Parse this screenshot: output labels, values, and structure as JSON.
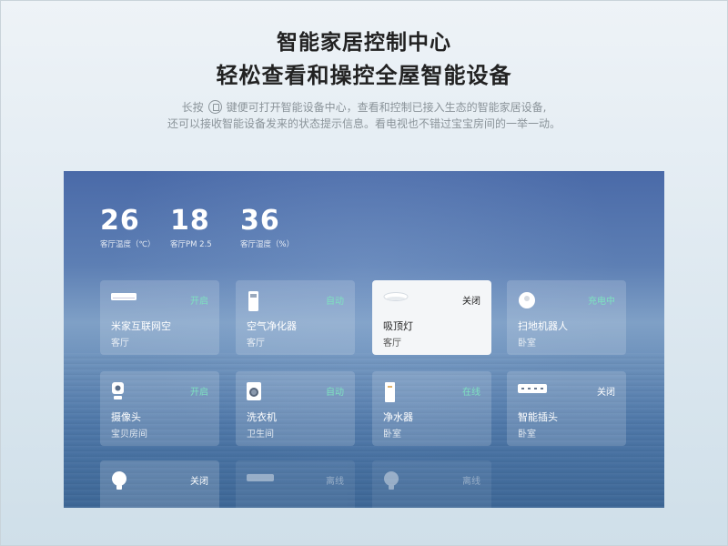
{
  "header": {
    "title": "智能家居控制中心",
    "subtitle": "轻松查看和操控全屋智能设备",
    "desc_prefix": "长按",
    "desc_line1_rest": "键便可打开智能设备中心，查看和控制已接入生态的智能家居设备,",
    "desc_line2": "还可以接收智能设备发来的状态提示信息。看电视也不错过宝宝房间的一举一动。",
    "home_icon": "home-key-icon"
  },
  "stats": [
    {
      "value": "26",
      "label": "客厅温度（℃）"
    },
    {
      "value": "18",
      "label": "客厅PM 2.5"
    },
    {
      "value": "36",
      "label": "客厅湿度（%）"
    }
  ],
  "devices": [
    {
      "name": "米家互联网空",
      "room": "客厅",
      "status": "开启",
      "icon": "air-conditioner-icon"
    },
    {
      "name": "空气净化器",
      "room": "客厅",
      "status": "自动",
      "icon": "air-purifier-icon"
    },
    {
      "name": "吸顶灯",
      "room": "客厅",
      "status": "关闭",
      "icon": "ceiling-light-icon"
    },
    {
      "name": "扫地机器人",
      "room": "卧室",
      "status": "充电中",
      "icon": "robot-vacuum-icon"
    },
    {
      "name": "摄像头",
      "room": "宝贝房间",
      "status": "开启",
      "icon": "camera-icon"
    },
    {
      "name": "洗衣机",
      "room": "卫生间",
      "status": "自动",
      "icon": "washing-machine-icon"
    },
    {
      "name": "净水器",
      "room": "卧室",
      "status": "在线",
      "icon": "water-purifier-icon"
    },
    {
      "name": "智能插头",
      "room": "卧室",
      "status": "关闭",
      "icon": "power-strip-icon"
    },
    {
      "name": "",
      "room": "",
      "status": "关闭",
      "icon": "bulb-icon"
    },
    {
      "name": "",
      "room": "",
      "status": "离线",
      "icon": "keyboard-icon"
    },
    {
      "name": "",
      "room": "",
      "status": "离线",
      "icon": "bulb-icon"
    }
  ],
  "colors": {
    "status_on": "#7ee2c0",
    "selected_card": "#f4f6f8"
  }
}
